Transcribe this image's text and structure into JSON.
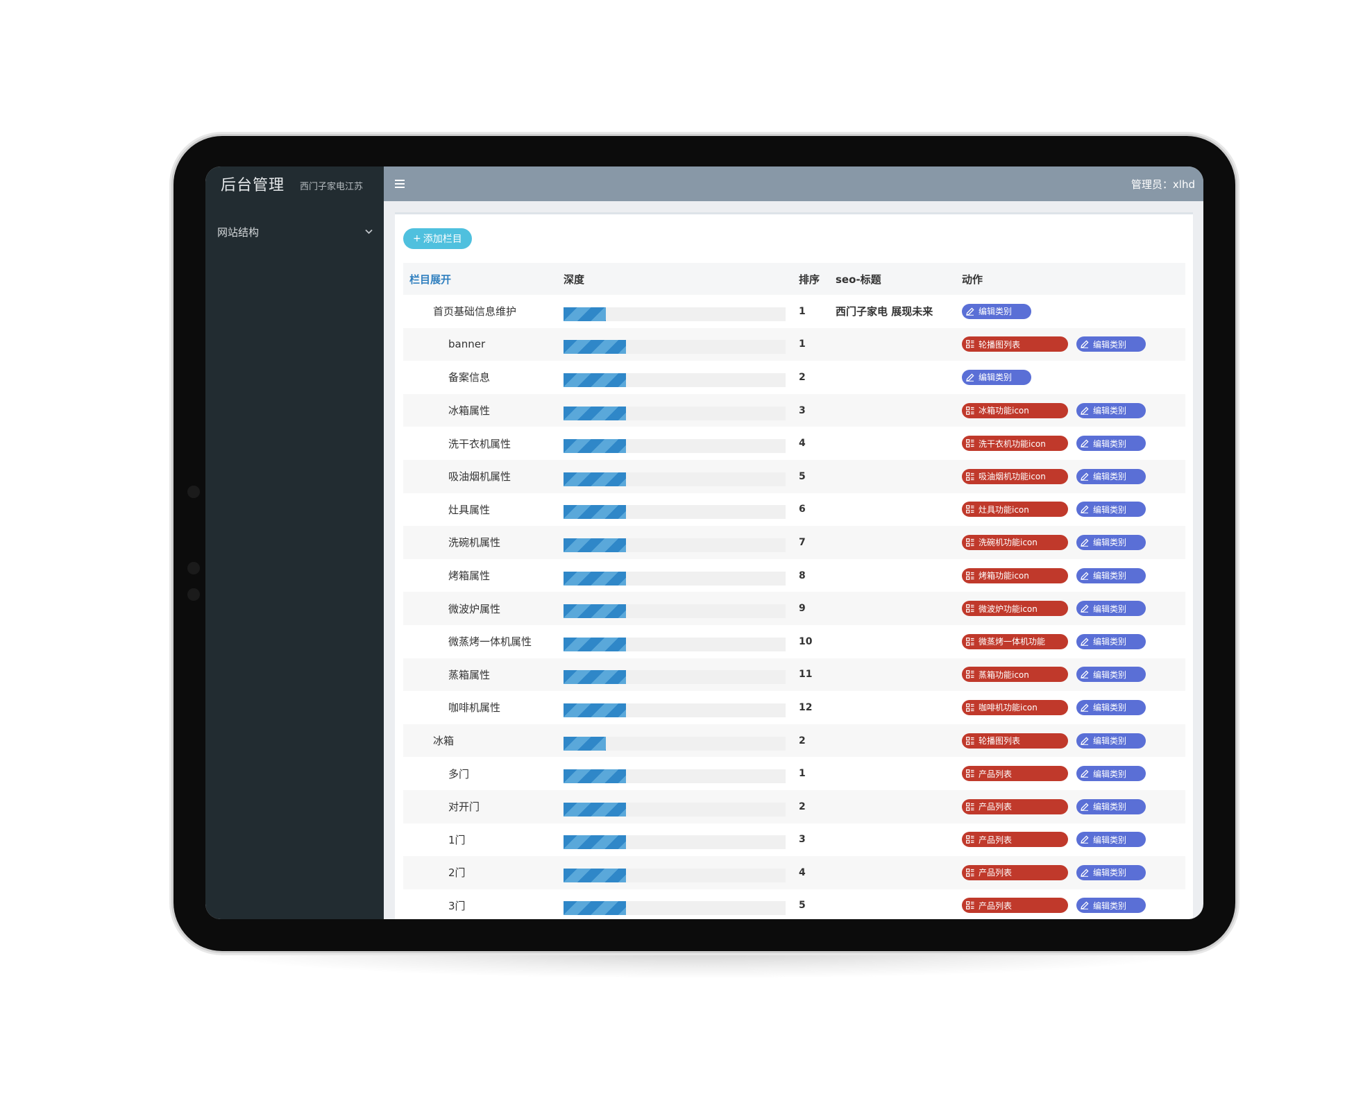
{
  "app": {
    "title": "后台管理",
    "subtitle": "西门子家电江苏"
  },
  "topbar": {
    "menu_icon": "hamburger-icon",
    "admin_label": "管理员：xlhd"
  },
  "sidebar": {
    "group_label": "网站结构",
    "group_icon": "chevron-down-icon"
  },
  "toolbar": {
    "add_label": "添加栏目",
    "add_icon": "plus-icon"
  },
  "table": {
    "headers": {
      "name": "栏目展开",
      "depth": "深度",
      "order": "排序",
      "seo": "seo-标题",
      "action": "动作"
    },
    "rows": [
      {
        "name": "首页基础信息维护",
        "level": 1,
        "depth_fill": 0.19,
        "order": "1",
        "seo": "西门子家电 展现未来",
        "actions": [
          {
            "label": "编辑类别",
            "style": "blue",
            "icon": "edit-icon"
          }
        ]
      },
      {
        "name": "banner",
        "level": 2,
        "depth_fill": 0.28,
        "order": "1",
        "seo": "",
        "actions": [
          {
            "label": "轮播图列表",
            "style": "red",
            "icon": "grid-icon"
          },
          {
            "label": "编辑类别",
            "style": "blue",
            "icon": "edit-icon"
          }
        ]
      },
      {
        "name": "备案信息",
        "level": 2,
        "depth_fill": 0.28,
        "order": "2",
        "seo": "",
        "actions": [
          {
            "label": "编辑类别",
            "style": "blue",
            "icon": "edit-icon"
          }
        ]
      },
      {
        "name": "冰箱属性",
        "level": 2,
        "depth_fill": 0.28,
        "order": "3",
        "seo": "",
        "actions": [
          {
            "label": "冰箱功能icon",
            "style": "red",
            "icon": "grid-icon"
          },
          {
            "label": "编辑类别",
            "style": "blue",
            "icon": "edit-icon"
          }
        ]
      },
      {
        "name": "洗干衣机属性",
        "level": 2,
        "depth_fill": 0.28,
        "order": "4",
        "seo": "",
        "actions": [
          {
            "label": "洗干衣机功能icon",
            "style": "red",
            "icon": "grid-icon"
          },
          {
            "label": "编辑类别",
            "style": "blue",
            "icon": "edit-icon"
          }
        ]
      },
      {
        "name": "吸油烟机属性",
        "level": 2,
        "depth_fill": 0.28,
        "order": "5",
        "seo": "",
        "actions": [
          {
            "label": "吸油烟机功能icon",
            "style": "red",
            "icon": "grid-icon"
          },
          {
            "label": "编辑类别",
            "style": "blue",
            "icon": "edit-icon"
          }
        ]
      },
      {
        "name": "灶具属性",
        "level": 2,
        "depth_fill": 0.28,
        "order": "6",
        "seo": "",
        "actions": [
          {
            "label": "灶具功能icon",
            "style": "red",
            "icon": "grid-icon"
          },
          {
            "label": "编辑类别",
            "style": "blue",
            "icon": "edit-icon"
          }
        ]
      },
      {
        "name": "洗碗机属性",
        "level": 2,
        "depth_fill": 0.28,
        "order": "7",
        "seo": "",
        "actions": [
          {
            "label": "洗碗机功能icon",
            "style": "red",
            "icon": "grid-icon"
          },
          {
            "label": "编辑类别",
            "style": "blue",
            "icon": "edit-icon"
          }
        ]
      },
      {
        "name": "烤箱属性",
        "level": 2,
        "depth_fill": 0.28,
        "order": "8",
        "seo": "",
        "actions": [
          {
            "label": "烤箱功能icon",
            "style": "red",
            "icon": "grid-icon"
          },
          {
            "label": "编辑类别",
            "style": "blue",
            "icon": "edit-icon"
          }
        ]
      },
      {
        "name": "微波炉属性",
        "level": 2,
        "depth_fill": 0.28,
        "order": "9",
        "seo": "",
        "actions": [
          {
            "label": "微波炉功能icon",
            "style": "red",
            "icon": "grid-icon"
          },
          {
            "label": "编辑类别",
            "style": "blue",
            "icon": "edit-icon"
          }
        ]
      },
      {
        "name": "微蒸烤一体机属性",
        "level": 2,
        "depth_fill": 0.28,
        "order": "10",
        "seo": "",
        "actions": [
          {
            "label": "微蒸烤一体机功能",
            "style": "red",
            "icon": "grid-icon"
          },
          {
            "label": "编辑类别",
            "style": "blue",
            "icon": "edit-icon"
          }
        ]
      },
      {
        "name": "蒸箱属性",
        "level": 2,
        "depth_fill": 0.28,
        "order": "11",
        "seo": "",
        "actions": [
          {
            "label": "蒸箱功能icon",
            "style": "red",
            "icon": "grid-icon"
          },
          {
            "label": "编辑类别",
            "style": "blue",
            "icon": "edit-icon"
          }
        ]
      },
      {
        "name": "咖啡机属性",
        "level": 2,
        "depth_fill": 0.28,
        "order": "12",
        "seo": "",
        "actions": [
          {
            "label": "咖啡机功能icon",
            "style": "red",
            "icon": "grid-icon"
          },
          {
            "label": "编辑类别",
            "style": "blue",
            "icon": "edit-icon"
          }
        ]
      },
      {
        "name": "冰箱",
        "level": 1,
        "depth_fill": 0.19,
        "order": "2",
        "seo": "",
        "actions": [
          {
            "label": "轮播图列表",
            "style": "red",
            "icon": "grid-icon"
          },
          {
            "label": "编辑类别",
            "style": "blue",
            "icon": "edit-icon"
          }
        ]
      },
      {
        "name": "多门",
        "level": 2,
        "depth_fill": 0.28,
        "order": "1",
        "seo": "",
        "actions": [
          {
            "label": "产品列表",
            "style": "red",
            "icon": "grid-icon"
          },
          {
            "label": "编辑类别",
            "style": "blue",
            "icon": "edit-icon"
          }
        ]
      },
      {
        "name": "对开门",
        "level": 2,
        "depth_fill": 0.28,
        "order": "2",
        "seo": "",
        "actions": [
          {
            "label": "产品列表",
            "style": "red",
            "icon": "grid-icon"
          },
          {
            "label": "编辑类别",
            "style": "blue",
            "icon": "edit-icon"
          }
        ]
      },
      {
        "name": "1门",
        "level": 2,
        "depth_fill": 0.28,
        "order": "3",
        "seo": "",
        "actions": [
          {
            "label": "产品列表",
            "style": "red",
            "icon": "grid-icon"
          },
          {
            "label": "编辑类别",
            "style": "blue",
            "icon": "edit-icon"
          }
        ]
      },
      {
        "name": "2门",
        "level": 2,
        "depth_fill": 0.28,
        "order": "4",
        "seo": "",
        "actions": [
          {
            "label": "产品列表",
            "style": "red",
            "icon": "grid-icon"
          },
          {
            "label": "编辑类别",
            "style": "blue",
            "icon": "edit-icon"
          }
        ]
      },
      {
        "name": "3门",
        "level": 2,
        "depth_fill": 0.28,
        "order": "5",
        "seo": "",
        "actions": [
          {
            "label": "产品列表",
            "style": "red",
            "icon": "grid-icon"
          },
          {
            "label": "编辑类别",
            "style": "blue",
            "icon": "edit-icon"
          }
        ]
      }
    ]
  },
  "colors": {
    "sidebar_bg": "#222c31",
    "topbar_bg": "#8898a7",
    "add_button": "#4fc0de",
    "red_button": "#c0392b",
    "blue_button": "#5a6fd6",
    "depth_bar": "#2f87c8",
    "link": "#2f7fbf"
  }
}
